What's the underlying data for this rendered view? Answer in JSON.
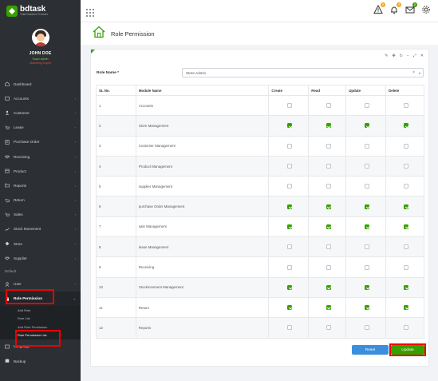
{
  "brand": {
    "name": "bdtask",
    "tagline": "Total Solution Provider"
  },
  "user": {
    "name": "JOHN DOE",
    "status": "Super Admin",
    "role": "Marketing Expert"
  },
  "sidebar": {
    "items": [
      {
        "label": "Dashboard",
        "icon": "home-icon",
        "has_children": false
      },
      {
        "label": "Accounts",
        "icon": "wallet-icon",
        "has_children": true
      },
      {
        "label": "Customer",
        "icon": "user-icon",
        "has_children": true
      },
      {
        "label": "Lease",
        "icon": "cart-icon",
        "has_children": true
      },
      {
        "label": "Purchase Order",
        "icon": "order-icon",
        "has_children": true
      },
      {
        "label": "Receiving",
        "icon": "handshake-icon",
        "has_children": true
      },
      {
        "label": "Product",
        "icon": "box-icon",
        "has_children": true
      },
      {
        "label": "Reports",
        "icon": "folder-icon",
        "has_children": true
      },
      {
        "label": "Return",
        "icon": "return-icon",
        "has_children": true
      },
      {
        "label": "Sales",
        "icon": "cart-icon",
        "has_children": true
      },
      {
        "label": "Stock Movement",
        "icon": "stock-icon",
        "has_children": true
      },
      {
        "label": "Store",
        "icon": "store-icon",
        "has_children": true
      },
      {
        "label": "Supplier",
        "icon": "handshake-icon",
        "has_children": true
      }
    ],
    "section_default": "Default",
    "user_item": {
      "label": "User",
      "icon": "users-icon"
    },
    "role_permission": {
      "label": "Role Permission",
      "subitems": [
        "Add Role",
        "Role List",
        "Add Role Permission",
        "Role Permission List"
      ]
    },
    "language": {
      "label": "Language",
      "icon": "language-icon"
    },
    "backup": {
      "label": "Backup",
      "icon": "database-icon"
    }
  },
  "topbar": {
    "badges": [
      "5",
      "3",
      "0"
    ]
  },
  "page": {
    "title": "Role Permission"
  },
  "form": {
    "role_label": "Role Name *",
    "role_value": "Store Admin",
    "clear_glyph": "×",
    "dropdown_glyph": "▾"
  },
  "table": {
    "headers": [
      "SL No.",
      "Module Name",
      "Create",
      "Read",
      "Update",
      "Delete"
    ],
    "rows": [
      {
        "sl": "1",
        "module": "Accounts",
        "perms": [
          false,
          false,
          false,
          false
        ]
      },
      {
        "sl": "2",
        "module": "Store Management",
        "perms": [
          true,
          true,
          true,
          true
        ]
      },
      {
        "sl": "3",
        "module": "Customer Management",
        "perms": [
          false,
          false,
          false,
          false
        ]
      },
      {
        "sl": "4",
        "module": "Product Management",
        "perms": [
          false,
          false,
          false,
          false
        ]
      },
      {
        "sl": "5",
        "module": "supplier Management",
        "perms": [
          false,
          false,
          false,
          false
        ]
      },
      {
        "sl": "6",
        "module": "purchase Order Management",
        "perms": [
          true,
          true,
          true,
          true
        ]
      },
      {
        "sl": "7",
        "module": "sale Management",
        "perms": [
          true,
          true,
          true,
          true
        ]
      },
      {
        "sl": "8",
        "module": "lease Management",
        "perms": [
          false,
          false,
          false,
          false
        ]
      },
      {
        "sl": "9",
        "module": "Receiving",
        "perms": [
          false,
          false,
          false,
          false
        ]
      },
      {
        "sl": "10",
        "module": "Stockmovment Management",
        "perms": [
          true,
          true,
          true,
          true
        ]
      },
      {
        "sl": "11",
        "module": "Return",
        "perms": [
          true,
          true,
          true,
          true
        ]
      },
      {
        "sl": "12",
        "module": "Reports",
        "perms": [
          false,
          false,
          false,
          false
        ]
      }
    ]
  },
  "buttons": {
    "reset": "Reset",
    "update": "Update"
  },
  "colors": {
    "accent": "#37a000",
    "sidebar": "#2c3034",
    "reset": "#3b8ede",
    "highlight": "#e00000"
  }
}
